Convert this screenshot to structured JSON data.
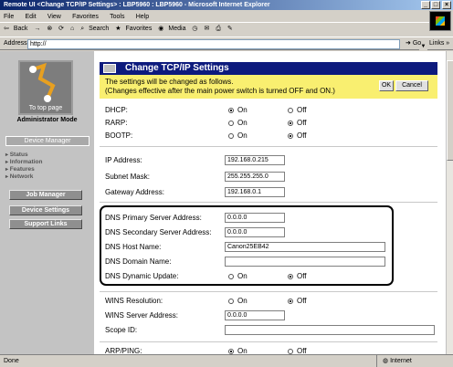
{
  "window": {
    "title": "Remote UI <Change TCP/IP Settings> : LBP5960 : LBP5960 - Microsoft Internet Explorer"
  },
  "menu": [
    "File",
    "Edit",
    "View",
    "Favorites",
    "Tools",
    "Help"
  ],
  "toolbar": {
    "back": "Back",
    "forward": "→",
    "search": "Search",
    "favorites": "Favorites",
    "media": "Media"
  },
  "address": {
    "label": "Address",
    "value": "http://",
    "go": "Go",
    "links": "Links »"
  },
  "sidebar": {
    "logo_label": "To top page",
    "mode": "Administrator Mode",
    "device_manager": "Device Manager",
    "nav": [
      "Status",
      "Information",
      "Features",
      "Network"
    ],
    "job_manager": "Job Manager",
    "device_settings": "Device Settings",
    "support_links": "Support Links"
  },
  "page": {
    "title": "Change TCP/IP Settings",
    "notice_line1": "The settings will be changed as follows.",
    "notice_line2": "(Changes effective after the main power switch is turned OFF and ON.)",
    "ok": "OK",
    "cancel": "Cancel"
  },
  "on_label": "On",
  "off_label": "Off",
  "settings": {
    "dhcp": {
      "label": "DHCP:",
      "value": "On"
    },
    "rarp": {
      "label": "RARP:",
      "value": "Off"
    },
    "bootp": {
      "label": "BOOTP:",
      "value": "Off"
    },
    "ip": {
      "label": "IP Address:",
      "value": "192.168.0.215"
    },
    "subnet": {
      "label": "Subnet Mask:",
      "value": "255.255.255.0"
    },
    "gateway": {
      "label": "Gateway Address:",
      "value": "192.168.0.1"
    },
    "dns_primary": {
      "label": "DNS Primary Server Address:",
      "value": "0.0.0.0"
    },
    "dns_secondary": {
      "label": "DNS Secondary Server Address:",
      "value": "0.0.0.0"
    },
    "dns_host": {
      "label": "DNS Host Name:",
      "value": "Canon25EB42"
    },
    "dns_domain": {
      "label": "DNS Domain Name:",
      "value": ""
    },
    "dns_dynamic": {
      "label": "DNS Dynamic Update:",
      "value": "Off"
    },
    "wins_res": {
      "label": "WINS Resolution:",
      "value": "Off"
    },
    "wins_server": {
      "label": "WINS Server Address:",
      "value": "0.0.0.0"
    },
    "scope": {
      "label": "Scope ID:",
      "value": ""
    },
    "arp_ping": {
      "label": "ARP/PING:"
    }
  },
  "status": {
    "done": "Done",
    "zone": "Internet"
  }
}
